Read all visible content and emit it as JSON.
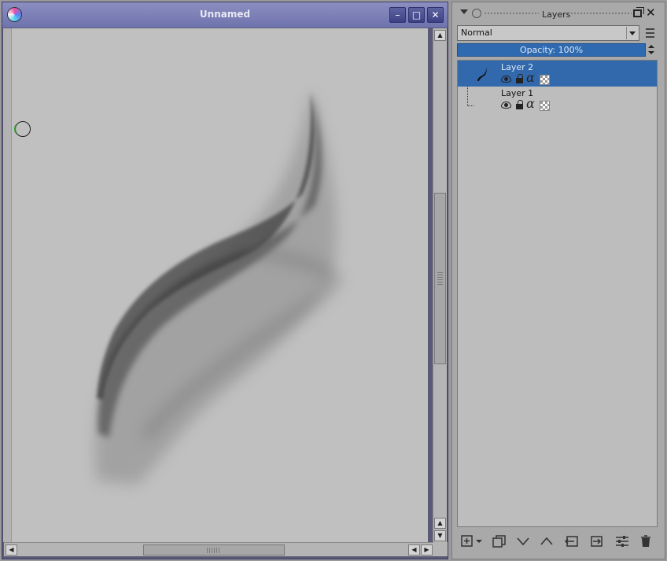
{
  "document_window": {
    "title": "Unnamed",
    "minimize_symbol": "–",
    "maximize_symbol": "□",
    "close_symbol": "✕",
    "icon": "app-logo-icon"
  },
  "canvas": {
    "background_color": "#c0c0c0"
  },
  "layers_docker": {
    "title": "Layers",
    "blend_mode": "Normal",
    "opacity_label": "Opacity:  100%",
    "opacity_value": 100,
    "layers": [
      {
        "name": "Layer 2",
        "selected": true,
        "visible": true,
        "locked": false
      },
      {
        "name": "Layer 1",
        "selected": false,
        "visible": true,
        "locked": false
      }
    ],
    "selection_color": "#3269ad",
    "toolbar_icons": [
      "add-layer-icon",
      "add-layer-dropdown-icon",
      "duplicate-layer-icon",
      "move-down-icon",
      "move-up-icon",
      "lower-icon",
      "raise-icon",
      "layer-properties-icon",
      "delete-layer-icon"
    ]
  }
}
